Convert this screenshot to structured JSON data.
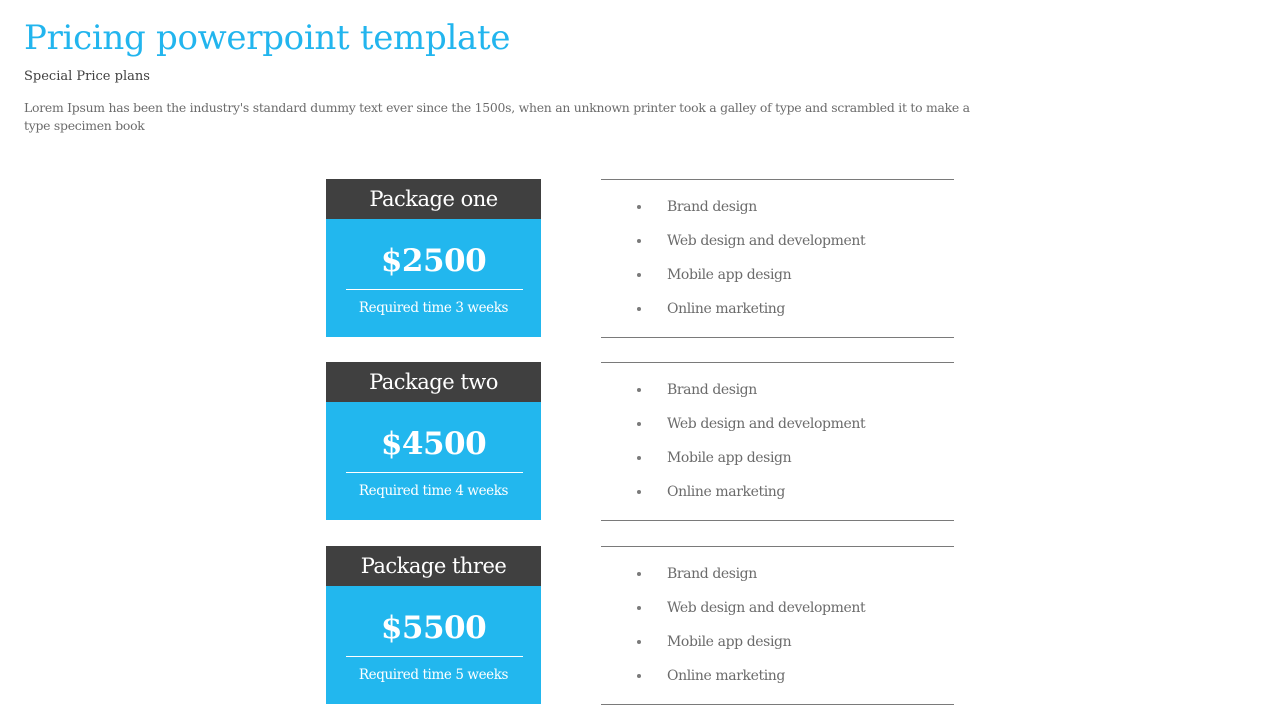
{
  "header": {
    "title": "Pricing powerpoint template",
    "subtitle": "Special Price plans",
    "description": "Lorem Ipsum has been the industry's standard dummy text ever since the 1500s, when an unknown printer took a galley of type and scrambled it to make a type specimen book"
  },
  "colors": {
    "accent": "#22b7ee",
    "header_dark": "#404040",
    "text_gray": "#6b6b6b"
  },
  "packages": [
    {
      "name": "Package one",
      "price": "$2500",
      "time": "Required time 3 weeks",
      "features": [
        "Brand design",
        "Web design and development",
        "Mobile app design",
        "Online marketing"
      ]
    },
    {
      "name": "Package two",
      "price": "$4500",
      "time": "Required time 4 weeks",
      "features": [
        "Brand design",
        "Web design and development",
        "Mobile app design",
        "Online marketing"
      ]
    },
    {
      "name": "Package three",
      "price": "$5500",
      "time": "Required time 5 weeks",
      "features": [
        "Brand design",
        "Web design and development",
        "Mobile app design",
        "Online marketing"
      ]
    }
  ]
}
